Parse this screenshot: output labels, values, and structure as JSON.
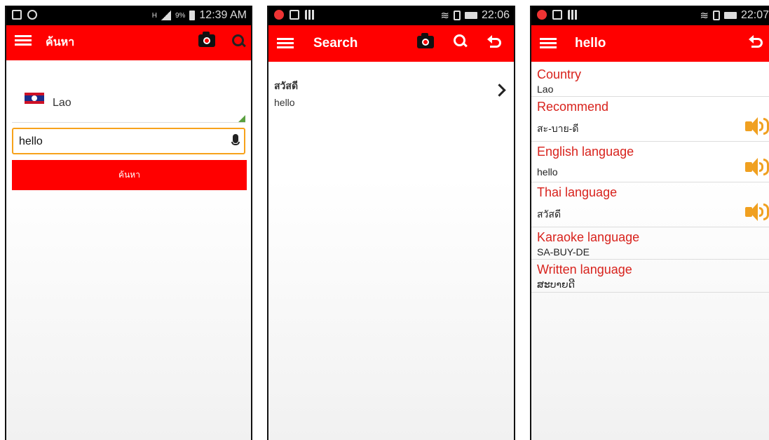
{
  "colors": {
    "accent": "#ff0000",
    "label_red": "#d8221c",
    "input_border": "#f7a21b",
    "speaker": "#f0a020"
  },
  "screen1": {
    "status": {
      "network": "H",
      "battery": "9%",
      "time": "12:39 AM"
    },
    "title": "ค้นหา",
    "icons": [
      "menu-icon",
      "camera-icon",
      "search-icon"
    ],
    "country": "Lao",
    "search_value": "hello",
    "button_label": "ค้นหา"
  },
  "screen2": {
    "status": {
      "time": "22:06"
    },
    "title": "Search",
    "icons": [
      "menu-icon",
      "camera-icon",
      "search-icon",
      "back-icon"
    ],
    "results": [
      {
        "thai": "สวัสดี",
        "english": "hello"
      }
    ]
  },
  "screen3": {
    "status": {
      "time": "22:07"
    },
    "title": "hello",
    "icons": [
      "menu-icon",
      "back-icon"
    ],
    "fields": [
      {
        "label": "Country",
        "value": "Lao",
        "sound": false
      },
      {
        "label": "Recommend",
        "value": "สะ-บาย-ดี",
        "sound": true
      },
      {
        "label": "English language",
        "value": "hello",
        "sound": true
      },
      {
        "label": "Thai language",
        "value": "สวัสดี",
        "sound": true
      },
      {
        "label": "Karaoke language",
        "value": "SA-BUY-DE",
        "sound": false
      },
      {
        "label": "Written language",
        "value": "ສະບາຍດີ",
        "sound": false
      }
    ]
  }
}
